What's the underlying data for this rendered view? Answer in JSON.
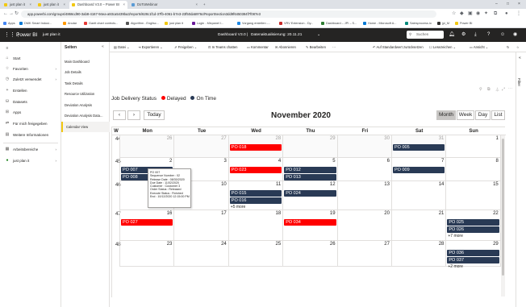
{
  "browser": {
    "tabs": [
      {
        "label": "just plan it",
        "active": false
      },
      {
        "label": "just plan it",
        "active": false
      },
      {
        "label": "Dashboard V3.0 – Power BI",
        "active": true
      },
      {
        "label": "DoToWebinar",
        "active": false
      }
    ],
    "new_tab": "+",
    "url": "app.powerbi.com/groups/4866cd90-3ab8-4167-94ea-a93ca5439ba3/reports/628c1f1d-37fb-4061-b7e3-23f50da5976c/ReportSection3dd9f6450384f7f087e3",
    "bookmarks": [
      "Apps",
      "DMK Smart Indusi...",
      "Anutar",
      "Gantt chart controls...",
      "Algorithm - Englisc...",
      "just plan it",
      "Login - Mixpanel I...",
      "Vorgang erstellen -...",
      "VRV Extension - Dy...",
      "Dashboard – JPI – S...",
      "Home - Microsoft A...",
      "Salesprocess.io",
      "jpi_M",
      "Power BI"
    ]
  },
  "pbi": {
    "brand": "Power BI",
    "workspace": "just plan it",
    "report_title": "Dashboard V3.0",
    "separator": "|",
    "data_updated": "Datenaktualisierung: 20.11.21",
    "search_placeholder": "Suchen"
  },
  "leftnav": {
    "items": [
      {
        "label": "Start",
        "icon": "home-icon"
      },
      {
        "label": "Favoriten",
        "icon": "star-icon",
        "chevron": true
      },
      {
        "label": "Zuletzt verwendet",
        "icon": "clock-icon",
        "chevron": true
      },
      {
        "label": "Erstellen",
        "icon": "plus-icon"
      },
      {
        "label": "Datasets",
        "icon": "database-icon"
      },
      {
        "label": "Apps",
        "icon": "apps-icon"
      },
      {
        "label": "Für mich freigegeben",
        "icon": "share-icon"
      },
      {
        "label": "Weitere Informationen",
        "icon": "book-icon"
      },
      {
        "label": "Arbeitsbereiche",
        "icon": "workspace-icon",
        "chevron": true
      },
      {
        "label": "just plan it",
        "icon": "workspace-icon",
        "chevron": true
      }
    ]
  },
  "pages": {
    "title": "Seiten",
    "items": [
      "Main Dashboard",
      "Job Details",
      "Task Details",
      "Resource Utilization",
      "Deviation Analysis",
      "Deviation Analysis Data...",
      "Calendar View"
    ],
    "selected_index": 6
  },
  "actionbar": {
    "items": [
      "Datei",
      "Exportieren",
      "Freigeben",
      "In Teams chatten",
      "Kommentar",
      "Abonnieren",
      "Bearbeiten"
    ],
    "reset": "Auf Standardwert zurücksetzen",
    "bookmarks": "Lesezeichen",
    "view": "Ansicht"
  },
  "filters_label": "Filter",
  "calendar": {
    "title": "Job Delivery Status",
    "legend": [
      {
        "label": "Delayed",
        "color": "#ff0000"
      },
      {
        "label": "On Time",
        "color": "#293a55"
      }
    ],
    "today_label": "Today",
    "month_title": "November 2020",
    "views": [
      "Month",
      "Week",
      "Day",
      "List"
    ],
    "active_view": "Month",
    "week_header": "W",
    "day_headers": [
      "Mon",
      "Tue",
      "Wed",
      "Thu",
      "Fri",
      "Sat",
      "Sun"
    ],
    "weeks": [
      {
        "week": "44",
        "days": [
          "26",
          "27",
          "28",
          "29",
          "30",
          "31",
          "1"
        ]
      },
      {
        "week": "45",
        "days": [
          "2",
          "3",
          "4",
          "5",
          "6",
          "7",
          "8"
        ]
      },
      {
        "week": "46",
        "days": [
          "9",
          "10",
          "11",
          "12",
          "13",
          "14",
          "15"
        ]
      },
      {
        "week": "47",
        "days": [
          "16",
          "17",
          "18",
          "19",
          "20",
          "21",
          "22"
        ]
      },
      {
        "week": "48",
        "days": [
          "23",
          "24",
          "25",
          "26",
          "27",
          "28",
          "29"
        ]
      }
    ],
    "events": [
      {
        "label": "PO 018",
        "status": "delayed",
        "week": 0,
        "day": 2,
        "slot": 0
      },
      {
        "label": "PO 005",
        "status": "ontime",
        "week": 0,
        "day": 5,
        "slot": 0
      },
      {
        "label": "PO 007",
        "status": "ontime",
        "week": 1,
        "day": 0,
        "slot": 0
      },
      {
        "label": "PO 008",
        "status": "ontime",
        "week": 1,
        "day": 0,
        "slot": 1
      },
      {
        "label": "PO 023",
        "status": "delayed",
        "week": 1,
        "day": 2,
        "slot": 0
      },
      {
        "label": "PO 012",
        "status": "ontime",
        "week": 1,
        "day": 3,
        "slot": 0
      },
      {
        "label": "PO 013",
        "status": "ontime",
        "week": 1,
        "day": 3,
        "slot": 1
      },
      {
        "label": "PO 009",
        "status": "ontime",
        "week": 1,
        "day": 5,
        "slot": 0
      },
      {
        "label": "PO 015",
        "status": "ontime",
        "week": 2,
        "day": 2,
        "slot": 0
      },
      {
        "label": "PO 016",
        "status": "ontime",
        "week": 2,
        "day": 2,
        "slot": 1
      },
      {
        "label": "PO 024",
        "status": "ontime",
        "week": 2,
        "day": 3,
        "slot": 0
      },
      {
        "label": "PO 027",
        "status": "delayed",
        "week": 3,
        "day": 0,
        "slot": 0
      },
      {
        "label": "PO 034",
        "status": "delayed",
        "week": 3,
        "day": 3,
        "slot": 0
      },
      {
        "label": "PO 025",
        "status": "ontime",
        "week": 3,
        "day": 6,
        "slot": 0
      },
      {
        "label": "PO 026",
        "status": "ontime",
        "week": 3,
        "day": 6,
        "slot": 1
      },
      {
        "label": "PO 036",
        "status": "ontime",
        "week": 4,
        "day": 6,
        "slot": 0
      },
      {
        "label": "PO 037",
        "status": "ontime",
        "week": 4,
        "day": 6,
        "slot": 1
      }
    ],
    "more_links": [
      {
        "label": "+5 more",
        "week": 2,
        "day": 2
      },
      {
        "label": "+7 more",
        "week": 3,
        "day": 6
      },
      {
        "label": "+2 more",
        "week": 4,
        "day": 6
      }
    ],
    "tooltip": [
      "PO 007",
      "Sequence Number : 02",
      "Release Date : 08/30/2020",
      "Due Date : 11/02/2020",
      "Customer : Customer 3",
      "Order Status : Released",
      "Execute Status : Finished",
      "End : 10/12/2020 12:15:00 PM"
    ]
  }
}
